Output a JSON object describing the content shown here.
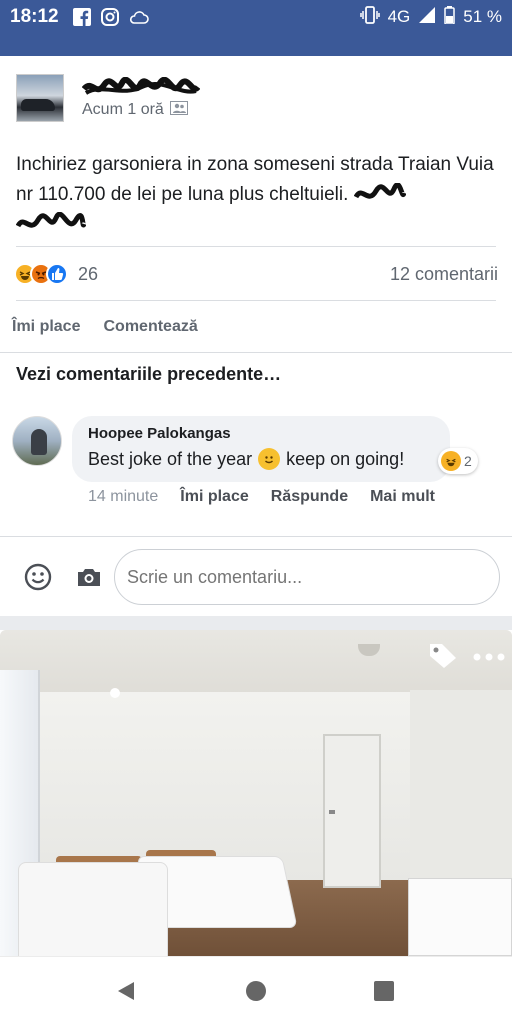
{
  "status_bar": {
    "time": "18:12",
    "network": "4G",
    "battery": "51 %"
  },
  "post": {
    "timestamp": "Acum 1 oră",
    "text": "Inchiriez garsoniera in zona someseni strada Traian Vuia nr 110.700 de lei pe luna plus cheltuieli.",
    "reactions": {
      "types": [
        "haha",
        "angry",
        "like"
      ],
      "count": "26"
    },
    "comment_count": "12 comentarii",
    "actions": {
      "like": "Îmi place",
      "comment": "Comentează"
    }
  },
  "comments": {
    "view_previous": "Vezi comentariile precedente…",
    "items": [
      {
        "author": "Hoopee Palokangas",
        "text_before": "Best joke of the year",
        "text_after": "keep on going!",
        "reaction_count": "2",
        "time": "14 minute",
        "like": "Îmi place",
        "reply": "Răspunde",
        "more": "Mai mult"
      }
    ]
  },
  "composer": {
    "placeholder": "Scrie un comentariu..."
  },
  "colors": {
    "facebook_blue": "#3b5998",
    "like_blue": "#1877f2",
    "haha_yellow": "#f7b125",
    "angry_orange": "#e9710f"
  },
  "icons": [
    "facebook-icon",
    "instagram-icon",
    "cloud-icon",
    "vibrate-icon",
    "signal-icon",
    "battery-icon",
    "friends-icon",
    "emoji-icon",
    "camera-icon",
    "tag-icon",
    "more-icon",
    "back-icon",
    "home-icon",
    "recents-icon"
  ]
}
